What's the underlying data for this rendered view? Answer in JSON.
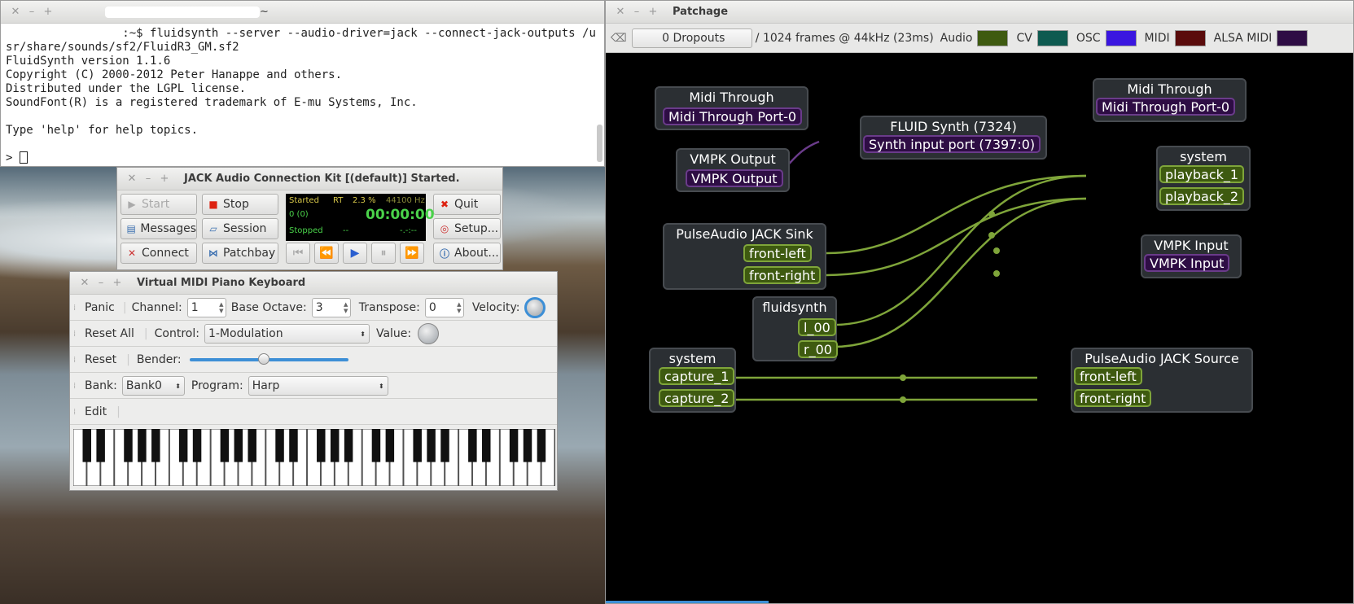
{
  "terminal": {
    "title": "~",
    "lines": [
      ":~$ fluidsynth --server --audio-driver=jack --connect-jack-outputs /usr/share/sounds/sf2/FluidR3_GM.sf2",
      "FluidSynth version 1.1.6",
      "Copyright (C) 2000-2012 Peter Hanappe and others.",
      "Distributed under the LGPL license.",
      "SoundFont(R) is a registered trademark of E-mu Systems, Inc.",
      "",
      "Type 'help' for help topics.",
      "",
      ">"
    ]
  },
  "jack": {
    "title": "JACK Audio Connection Kit [(default)] Started.",
    "buttons": {
      "start": "Start",
      "stop": "Stop",
      "quit": "Quit",
      "messages": "Messages",
      "session": "Session",
      "setup": "Setup...",
      "connect": "Connect",
      "patchbay": "Patchbay",
      "about": "About..."
    },
    "lcd": {
      "status": "Started",
      "rt": "RT",
      "cpu": "2.3 %",
      "rate": "44100 Hz",
      "xruns": "0 (0)",
      "time": "00:00:00",
      "transport": "Stopped",
      "dash1": "--",
      "dash2": "-.-:--"
    }
  },
  "vmpk": {
    "title": "Virtual MIDI Piano Keyboard",
    "panic": "Panic",
    "channel_label": "Channel:",
    "channel": "1",
    "octave_label": "Base Octave:",
    "octave": "3",
    "transpose_label": "Transpose:",
    "transpose": "0",
    "velocity_label": "Velocity:",
    "reset_all": "Reset All",
    "control_label": "Control:",
    "control": "1-Modulation",
    "value_label": "Value:",
    "reset": "Reset",
    "bender_label": "Bender:",
    "bender_level": 0.47,
    "bank_label": "Bank:",
    "bank": "Bank0",
    "program_label": "Program:",
    "program": "Harp",
    "edit": "Edit"
  },
  "patchage": {
    "title": "Patchage",
    "dropouts": "0 Dropouts",
    "frames": "/ 1024 frames @ 44kHz (23ms)",
    "legend": [
      {
        "label": "Audio",
        "color": "#3e5a10"
      },
      {
        "label": "CV",
        "color": "#0e5a50"
      },
      {
        "label": "OSC",
        "color": "#3a16e0"
      },
      {
        "label": "MIDI",
        "color": "#5a0c0c"
      },
      {
        "label": "ALSA MIDI",
        "color": "#2e0d44"
      }
    ],
    "modules": {
      "midi_through_l": {
        "title": "Midi Through",
        "port": "Midi Through Port-0"
      },
      "fluid": {
        "title": "FLUID Synth (7324)",
        "port": "Synth input port (7397:0)"
      },
      "vmpk_out": {
        "title": "VMPK Output",
        "port": "VMPK Output"
      },
      "midi_through_r": {
        "title": "Midi Through",
        "port": "Midi Through Port-0"
      },
      "system_out": {
        "title": "system",
        "p1": "playback_1",
        "p2": "playback_2"
      },
      "pulse_sink": {
        "title": "PulseAudio JACK Sink",
        "p1": "front-left",
        "p2": "front-right"
      },
      "vmpk_in": {
        "title": "VMPK Input",
        "port": "VMPK Input"
      },
      "fluidsynth": {
        "title": "fluidsynth",
        "p1": "l_00",
        "p2": "r_00"
      },
      "system_in": {
        "title": "system",
        "p1": "capture_1",
        "p2": "capture_2"
      },
      "pulse_source": {
        "title": "PulseAudio JACK Source",
        "p1": "front-left",
        "p2": "front-right"
      }
    }
  }
}
